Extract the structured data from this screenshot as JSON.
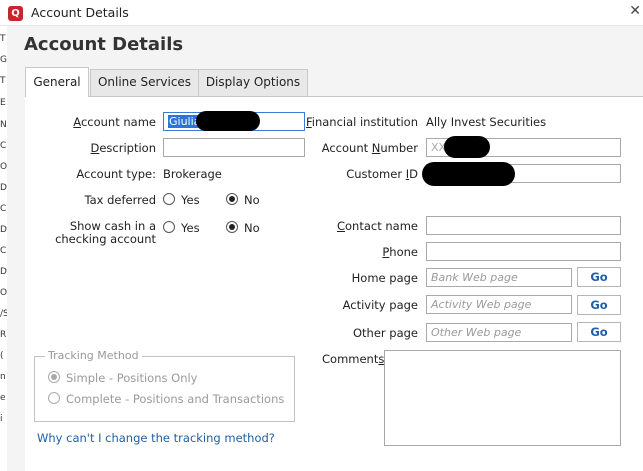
{
  "window": {
    "title": "Account Details",
    "logo_letter": "Q"
  },
  "left_strip_letters": [
    "T",
    "G",
    "T",
    "E",
    "N",
    "C",
    "O",
    "D",
    "C",
    "D",
    "C",
    "D",
    "O",
    "/S",
    "R",
    "(",
    "n",
    "e",
    "i"
  ],
  "page_title": "Account Details",
  "tabs": [
    {
      "label": "General",
      "active": true
    },
    {
      "label": "Online Services",
      "active": false
    },
    {
      "label": "Display Options",
      "active": false
    }
  ],
  "general": {
    "account_name": {
      "label_pre": "",
      "label_ul": "A",
      "label_post": "ccount name",
      "value": "Giulia"
    },
    "description": {
      "label_pre": "",
      "label_ul": "D",
      "label_post": "escription",
      "value": ""
    },
    "account_type": {
      "label": "Account type:",
      "value": "Brokerage"
    },
    "tax_deferred": {
      "label": "Tax deferred",
      "yes": "Yes",
      "no": "No",
      "selected": "No"
    },
    "show_cash": {
      "label_line1": "Show cash in a",
      "label_line2": "checking account",
      "yes": "Yes",
      "no": "No",
      "selected": "No"
    }
  },
  "institution": {
    "financial_institution": {
      "label_pre": "",
      "label_ul": "F",
      "label_post": "inancial institution",
      "value": "Ally Invest Securities"
    },
    "account_number": {
      "label_pre": "Account ",
      "label_ul": "N",
      "label_post": "umber",
      "value": "XX"
    },
    "customer_id": {
      "label_pre": "Customer ",
      "label_ul": "I",
      "label_post": "D",
      "value": ""
    },
    "contact_name": {
      "label_pre": "",
      "label_ul": "C",
      "label_post": "ontact name",
      "value": ""
    },
    "phone": {
      "label_pre": "",
      "label_ul": "P",
      "label_post": "hone",
      "value": ""
    },
    "home_page": {
      "label": "Home page",
      "placeholder": "Bank Web page",
      "go": "Go"
    },
    "activity_page": {
      "label": "Activity page",
      "placeholder": "Activity Web page",
      "go": "Go"
    },
    "other_page": {
      "label": "Other page",
      "placeholder": "Other Web page",
      "go": "Go"
    },
    "comments": {
      "label_pre": "Comment",
      "label_ul": "s",
      "label_post": ""
    }
  },
  "tracking": {
    "legend": "Tracking Method",
    "simple": "Simple - Positions Only",
    "complete": "Complete - Positions and Transactions",
    "selected": "simple",
    "link": "Why can't I change the tracking method?"
  }
}
